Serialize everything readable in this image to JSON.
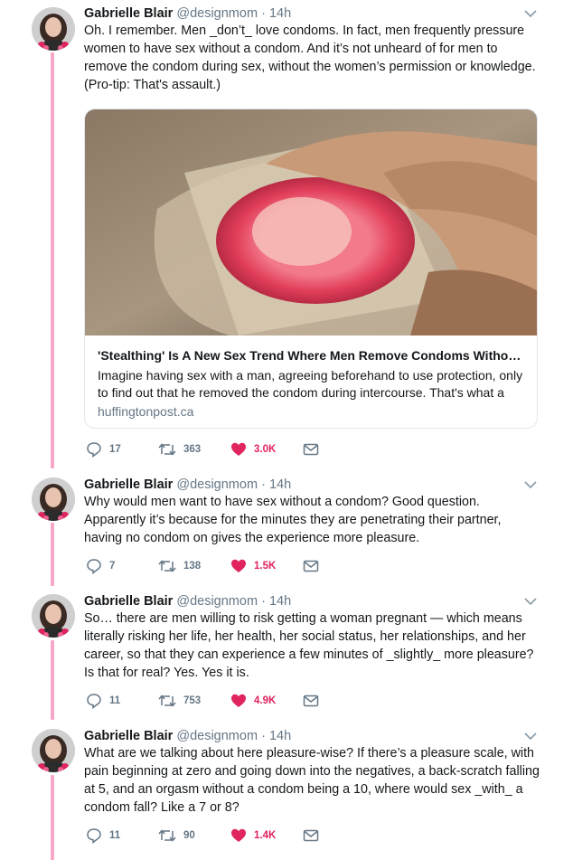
{
  "author": {
    "name": "Gabrielle Blair",
    "handle": "@designmom",
    "separator": "·"
  },
  "colors": {
    "thread_line": "#f7a7c8",
    "like_red": "#e0245e",
    "muted": "#657786"
  },
  "icons": {
    "reply": "reply-icon",
    "retweet": "retweet-icon",
    "like": "heart-icon",
    "dm": "envelope-icon",
    "more": "chevron-down-icon"
  },
  "tweets": [
    {
      "time": "14h",
      "text": "Oh. I remember. Men  _don’t_  love condoms. In fact, men frequently pressure women to have sex without a condom. And it’s not unheard of for men to remove the condom during sex, without the women’s permission or knowledge. (Pro-tip: That's assault.)",
      "replies": "17",
      "retweets": "363",
      "likes": "3.0K",
      "card": {
        "title": "'Stealthing' Is A New Sex Trend Where Men Remove Condoms Witho…",
        "description": "Imagine having sex with a man, agreeing beforehand to use protection, only to find out that he removed the condom during intercourse. That's what a",
        "domain": "huffingtonpost.ca"
      }
    },
    {
      "time": "14h",
      "text": "Why would men want to have sex without a condom? Good question. Apparently it’s because for the minutes they are penetrating their partner, having no condom on gives the experience more pleasure.",
      "replies": "7",
      "retweets": "138",
      "likes": "1.5K"
    },
    {
      "time": "14h",
      "text": "So… there are men willing to risk getting a woman pregnant — which means literally risking her life, her health, her social status, her relationships, and her career, so that they can experience a few minutes of _slightly_ more pleasure? Is that for real? Yes. Yes it is.",
      "replies": "11",
      "retweets": "753",
      "likes": "4.9K"
    },
    {
      "time": "14h",
      "text": "What are we talking about here pleasure-wise? If there’s a pleasure scale, with pain beginning at zero and going down into the negatives, a back-scratch falling at 5, and an orgasm without a condom being a 10, where would sex _with_ a condom fall? Like a 7 or 8?",
      "replies": "11",
      "retweets": "90",
      "likes": "1.4K"
    }
  ]
}
